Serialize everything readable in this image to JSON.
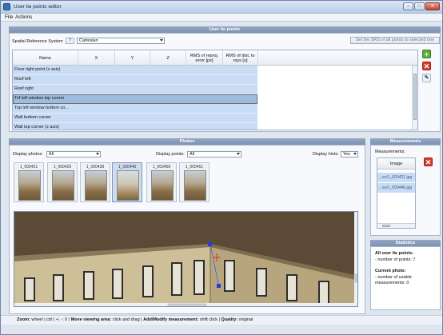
{
  "window": {
    "title": "User tie points editor"
  },
  "menu": {
    "file": "File",
    "actions": "Actions"
  },
  "tie_points": {
    "header": "User tie points",
    "srs_label": "Spatial Reference System",
    "srs_value": "Cartesian",
    "srs_button": "Set the SRS of all points to selected one",
    "columns": [
      "Name",
      "X",
      "Y",
      "Z",
      "RMS of reproj. error [px]",
      "RMS of dist. to rays [u]"
    ],
    "rows": [
      "Floor right point (x axis)",
      "Roof left",
      "Roof right",
      "Tof left window top corner",
      "Top left window bottom co...",
      "Wall bottom corner",
      "Wall top corner (z axis)"
    ],
    "selected_row": 3
  },
  "photos": {
    "header": "Photos",
    "display_photos_label": "Display photos:",
    "display_photos_value": "All",
    "display_points_label": "Display points:",
    "display_points_value": "All",
    "display_hints_label": "Display hints:",
    "display_hints_value": "Yes",
    "thumbnails": [
      "1_000421",
      "1_000426",
      "1_000438",
      "1_000446",
      "1_000458",
      "1_000461"
    ],
    "selected_thumbnail": 3
  },
  "measurements": {
    "header": "Measurements",
    "label": "Measurements:",
    "column": "Image",
    "items": [
      "...es/1_000421.jpg",
      "...es/1_000446.jpg"
    ]
  },
  "statistics": {
    "header": "Statistics",
    "all_title": "All user tie points:",
    "all_line": "- number of points: 7",
    "current_title": "Current photo:",
    "current_line1": "- number of usable",
    "current_line2": "measurements: 0"
  },
  "statusbar": {
    "zoom_label": "Zoom:",
    "zoom_value": "wheel | ctrl | +; -; 0 |",
    "move_label": "Move viewing area:",
    "move_value": "click and drag |",
    "add_label": "Add/Modify measurement:",
    "add_value": "shift click |",
    "quality_label": "Quality:",
    "quality_value": "original"
  }
}
